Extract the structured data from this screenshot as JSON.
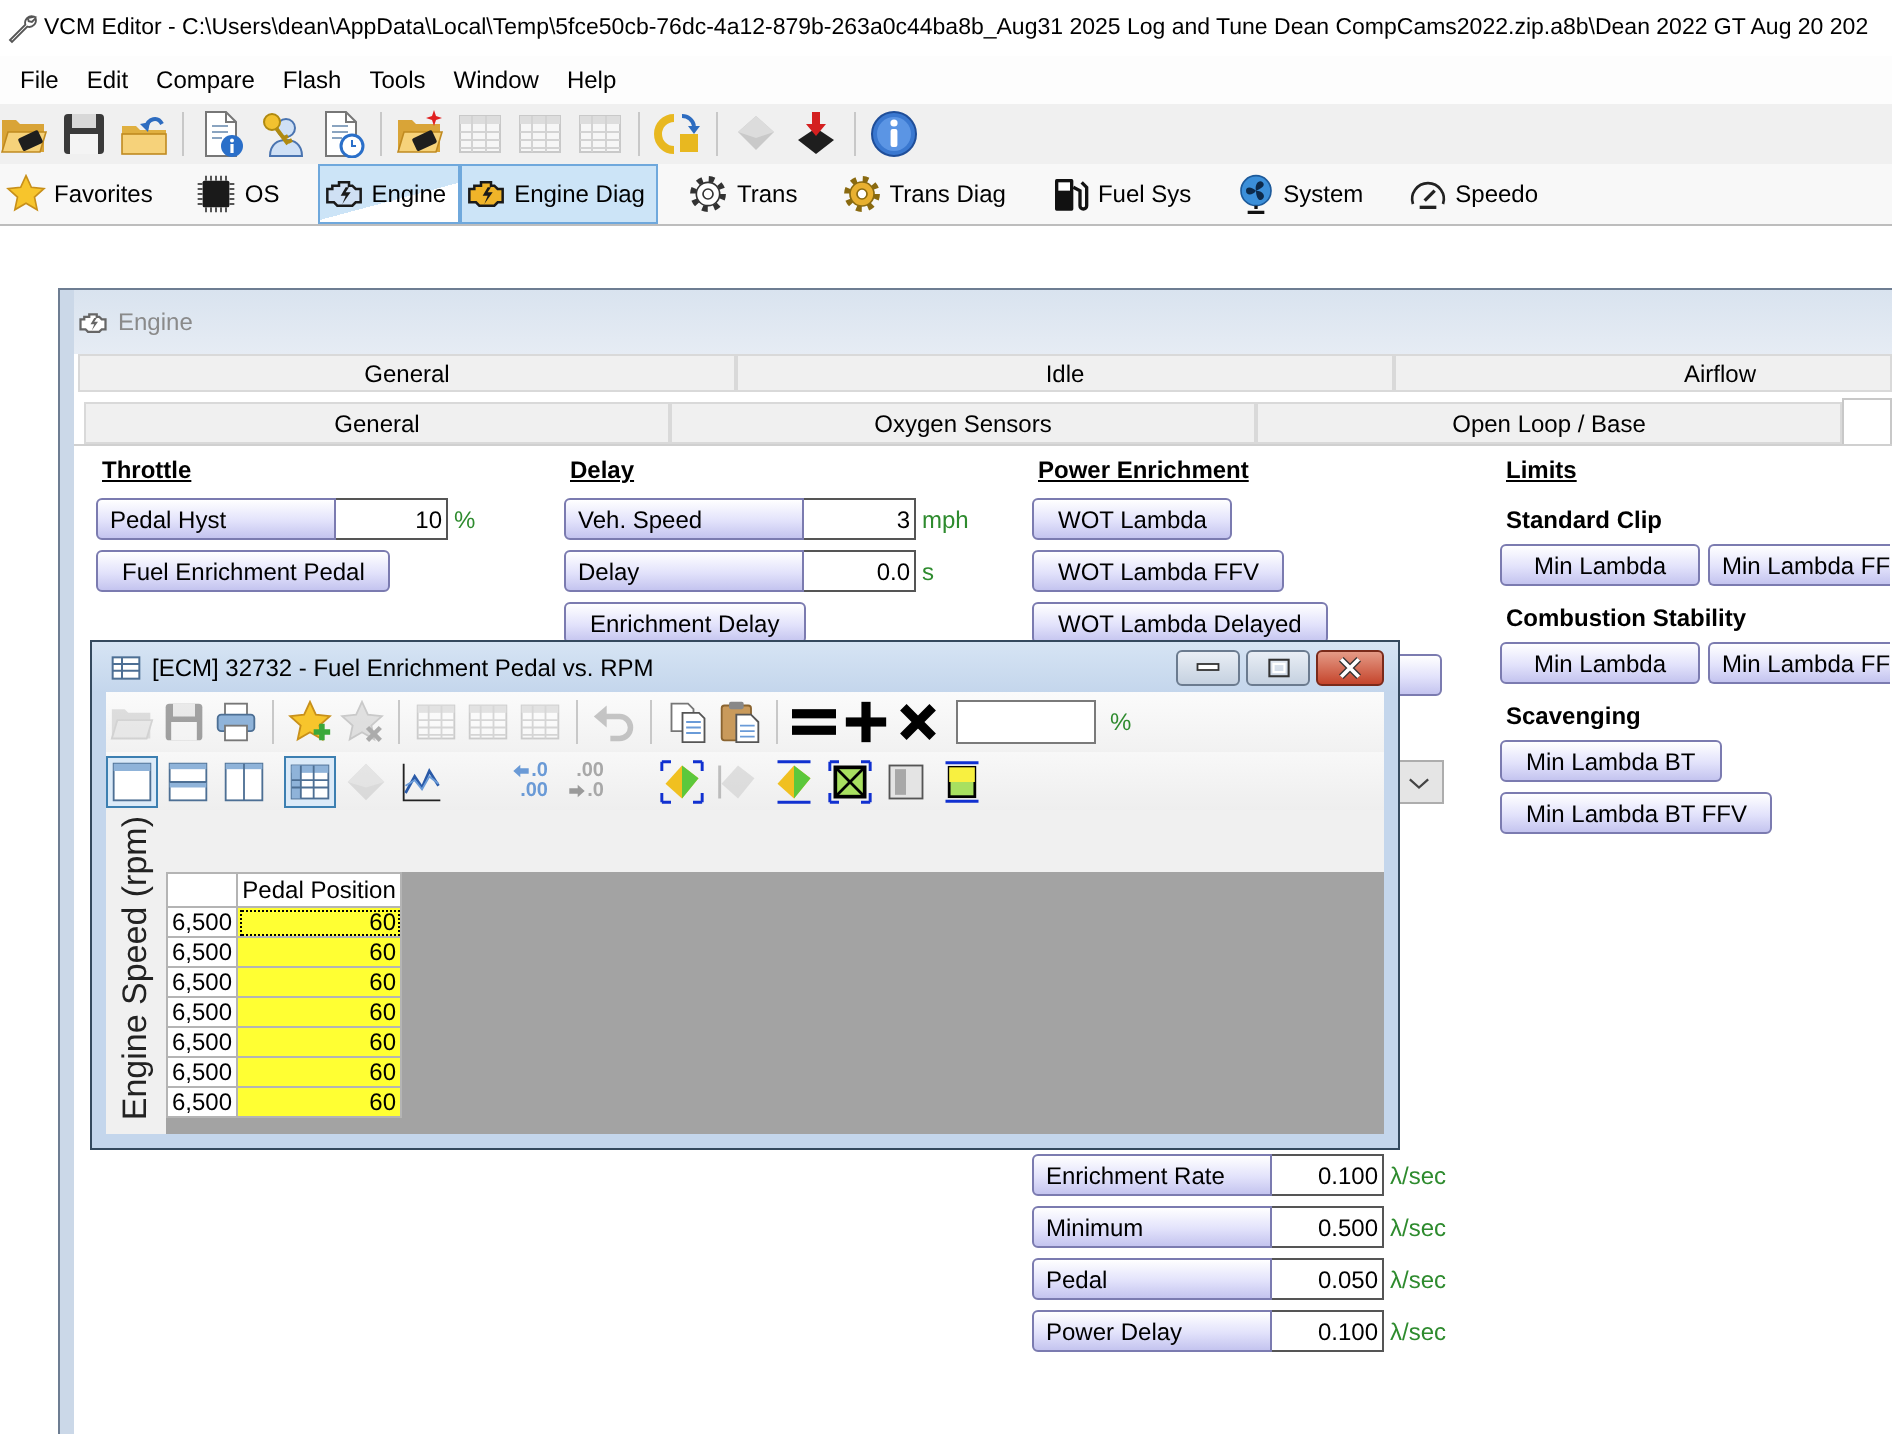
{
  "window": {
    "title": "VCM Editor - C:\\Users\\dean\\AppData\\Local\\Temp\\5fce50cb-76dc-4a12-879b-263a0c44ba8b_Aug31 2025 Log and Tune Dean CompCams2022.zip.a8b\\Dean 2022 GT Aug 20 202"
  },
  "menu": [
    "File",
    "Edit",
    "Compare",
    "Flash",
    "Tools",
    "Window",
    "Help"
  ],
  "toolbar": {
    "groups": [
      [
        {
          "kind": "open",
          "disabled": false
        },
        {
          "kind": "save",
          "disabled": false
        },
        {
          "kind": "reopen",
          "disabled": false
        }
      ],
      [
        {
          "kind": "docinfo",
          "disabled": false
        },
        {
          "kind": "keyuser",
          "disabled": false
        },
        {
          "kind": "docclock",
          "disabled": false
        }
      ],
      [
        {
          "kind": "folderspark",
          "disabled": false
        },
        {
          "kind": "table",
          "disabled": true
        },
        {
          "kind": "table",
          "disabled": true
        },
        {
          "kind": "table",
          "disabled": true
        }
      ],
      [
        {
          "kind": "cf",
          "disabled": false
        }
      ],
      [
        {
          "kind": "chip3d",
          "disabled": true
        },
        {
          "kind": "chipdown",
          "disabled": false
        }
      ],
      [
        {
          "kind": "info",
          "disabled": false
        }
      ]
    ]
  },
  "module_bar": [
    {
      "kind": "star",
      "label": "Favorites",
      "selected": false,
      "hovered": false
    },
    {
      "kind": "chip",
      "label": "OS",
      "selected": false,
      "hovered": false
    },
    {
      "kind": "engine",
      "label": "Engine",
      "selected": true,
      "hovered": true
    },
    {
      "kind": "enginediag",
      "label": "Engine Diag",
      "selected": true,
      "hovered": false
    },
    {
      "kind": "gear",
      "label": "Trans",
      "selected": false,
      "hovered": false
    },
    {
      "kind": "geargold",
      "label": "Trans Diag",
      "selected": false,
      "hovered": false
    },
    {
      "kind": "fuel",
      "label": "Fuel Sys",
      "selected": false,
      "hovered": false
    },
    {
      "kind": "fan",
      "label": "System",
      "selected": false,
      "hovered": false
    },
    {
      "kind": "gauge",
      "label": "Speedo",
      "selected": false,
      "hovered": false
    }
  ],
  "engine_window": {
    "title": "Engine",
    "tabs": [
      {
        "label": "General",
        "selected": false
      },
      {
        "label": "Idle",
        "selected": false
      },
      {
        "label": "Airflow",
        "selected": false
      }
    ],
    "subtabs": [
      {
        "label": "General",
        "selected": false
      },
      {
        "label": "Oxygen Sensors",
        "selected": false
      },
      {
        "label": "Open Loop / Base",
        "selected": false
      },
      {
        "selected": true
      }
    ],
    "sections": [
      {
        "heading": "Throttle",
        "items": [
          {
            "kind": "field",
            "label": "Pedal Hyst",
            "value": "10",
            "unit": "%"
          },
          {
            "kind": "button",
            "label": "Fuel Enrichment Pedal"
          }
        ]
      },
      {
        "heading": "Delay",
        "items": [
          {
            "kind": "field",
            "label": "Veh. Speed",
            "value": "3",
            "unit": "mph"
          },
          {
            "kind": "field",
            "label": "Delay",
            "value": "0.0",
            "unit": "s"
          },
          {
            "kind": "button",
            "label": "Enrichment Delay"
          }
        ]
      },
      {
        "heading": "Power Enrichment",
        "items": [
          {
            "kind": "button",
            "label": "WOT Lambda"
          },
          {
            "kind": "button",
            "label": "WOT Lambda FFV"
          },
          {
            "kind": "button",
            "label": "WOT Lambda Delayed"
          },
          {
            "kind": "button"
          },
          {
            "kind": "dropdown"
          },
          {
            "kind": "field",
            "label": "Enrichment Rate",
            "value": "0.100",
            "unit": "λ/sec"
          },
          {
            "kind": "field",
            "label": "Minimum",
            "value": "0.500",
            "unit": "λ/sec"
          },
          {
            "kind": "field",
            "label": "Pedal",
            "value": "0.050",
            "unit": "λ/sec"
          },
          {
            "kind": "field",
            "label": "Power Delay",
            "value": "0.100",
            "unit": "λ/sec"
          }
        ]
      },
      {
        "heading": "Limits",
        "items": [
          {
            "kind": "subheading",
            "label": "Standard Clip"
          },
          {
            "kind": "buttons",
            "labels": [
              "Min Lambda",
              "Min Lambda FF"
            ]
          },
          {
            "kind": "subheading",
            "label": "Combustion Stability"
          },
          {
            "kind": "buttons",
            "labels": [
              "Min Lambda",
              "Min Lambda FF"
            ]
          },
          {
            "kind": "subheading",
            "label": "Scavenging"
          },
          {
            "kind": "button",
            "label": "Min Lambda BT"
          },
          {
            "kind": "button",
            "label": "Min Lambda BT FFV"
          }
        ]
      }
    ]
  },
  "table_window": {
    "title": "[ECM] 32732 - Fuel Enrichment Pedal vs. RPM",
    "toolbar_row1": [
      [
        {
          "kind": "folder",
          "disabled": true
        },
        {
          "kind": "save",
          "disabled": true
        },
        {
          "kind": "print",
          "disabled": false
        }
      ],
      [
        {
          "kind": "starplus",
          "disabled": false
        },
        {
          "kind": "starx",
          "disabled": true
        }
      ],
      [
        {
          "kind": "table",
          "disabled": true
        },
        {
          "kind": "table",
          "disabled": true
        },
        {
          "kind": "table",
          "disabled": true
        }
      ],
      [
        {
          "kind": "undo",
          "disabled": true
        }
      ],
      [
        {
          "kind": "copy",
          "disabled": false
        },
        {
          "kind": "paste",
          "disabled": false
        }
      ],
      [
        {
          "kind": "equals",
          "disabled": false
        },
        {
          "kind": "plus",
          "disabled": false
        },
        {
          "kind": "times",
          "disabled": false
        }
      ]
    ],
    "value_field": {
      "unit": "%"
    },
    "toolbar_row2": [
      [
        {
          "kind": "single",
          "disabled": false,
          "selected": true
        },
        {
          "kind": "hsplit",
          "disabled": false,
          "selected": false
        },
        {
          "kind": "vsplit",
          "disabled": false,
          "selected": false
        }
      ],
      [
        {
          "kind": "grid",
          "disabled": false,
          "selected": true
        },
        {
          "kind": "diamond",
          "disabled": true,
          "selected": false
        },
        {
          "kind": "linechart",
          "disabled": false,
          "selected": false
        }
      ],
      [
        {
          "kind": "decup",
          "lines": [
            ".0",
            ".00"
          ],
          "disabled": false,
          "selected": false
        },
        {
          "kind": "decdown",
          "lines": [
            ".00",
            ".0"
          ],
          "disabled": true,
          "selected": false
        }
      ],
      [
        {
          "kind": "graddiamond",
          "disabled": false,
          "selected": false
        },
        {
          "kind": "halfdiamond",
          "disabled": true,
          "selected": false
        },
        {
          "kind": "graddiamond2",
          "disabled": false,
          "selected": false
        },
        {
          "kind": "xbox",
          "disabled": false,
          "selected": false
        },
        {
          "kind": "greyrect",
          "disabled": false,
          "selected": false
        },
        {
          "kind": "gradsquare",
          "disabled": false,
          "selected": false
        }
      ]
    ],
    "table": {
      "y_axis_label": "Engine Speed (rpm)",
      "columns": [
        "Pedal Position"
      ],
      "rows": [
        {
          "label": "6,500",
          "value": "60",
          "selected": true
        },
        {
          "label": "6,500",
          "value": "60",
          "selected": false
        },
        {
          "label": "6,500",
          "value": "60",
          "selected": false
        },
        {
          "label": "6,500",
          "value": "60",
          "selected": false
        },
        {
          "label": "6,500",
          "value": "60",
          "selected": false
        },
        {
          "label": "6,500",
          "value": "60",
          "selected": false
        },
        {
          "label": "6,500",
          "value": "60",
          "selected": false
        }
      ]
    }
  }
}
